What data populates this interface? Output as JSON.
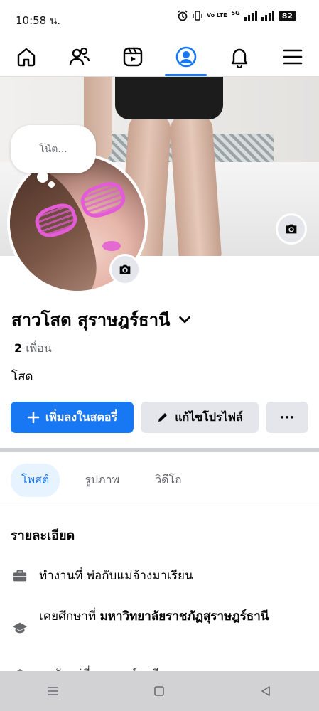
{
  "status_bar": {
    "time": "10:58 น.",
    "volte_label": "Vo LTE",
    "network": "5G",
    "battery": "82"
  },
  "nav": {
    "items": [
      {
        "icon": "home-icon"
      },
      {
        "icon": "friends-icon"
      },
      {
        "icon": "video-icon"
      },
      {
        "icon": "profile-icon",
        "active": true
      },
      {
        "icon": "bell-icon"
      },
      {
        "icon": "menu-icon"
      }
    ]
  },
  "note": {
    "placeholder": "โน้ต..."
  },
  "profile": {
    "name": "สาวโสด สุราษฎร์ธานี",
    "friends_count": "2",
    "friends_label": "เพื่อน",
    "relationship": "โสด"
  },
  "actions": {
    "add_story": "เพิ่มลงในสตอรี่",
    "edit_profile": "แก้ไขโปรไฟล์",
    "more": "···"
  },
  "tabs": [
    {
      "label": "โพสต์",
      "active": true
    },
    {
      "label": "รูปภาพ"
    },
    {
      "label": "วิดีโอ"
    }
  ],
  "details": {
    "title": "รายละเอียด",
    "work": "ทำงานที่ พ่อกับแม่จ้างมาเรียน",
    "education_prefix": "เคยศึกษาที่",
    "education_school": "มหาวิทยาลัยราชภัฏสุราษฎร์ธานี",
    "partial_line": "อาศัยอยู่ที่ สุราษฎร์ธานี"
  },
  "colors": {
    "accent": "#1877f2",
    "secondary_button": "#e4e6eb",
    "muted_text": "#65676b"
  }
}
